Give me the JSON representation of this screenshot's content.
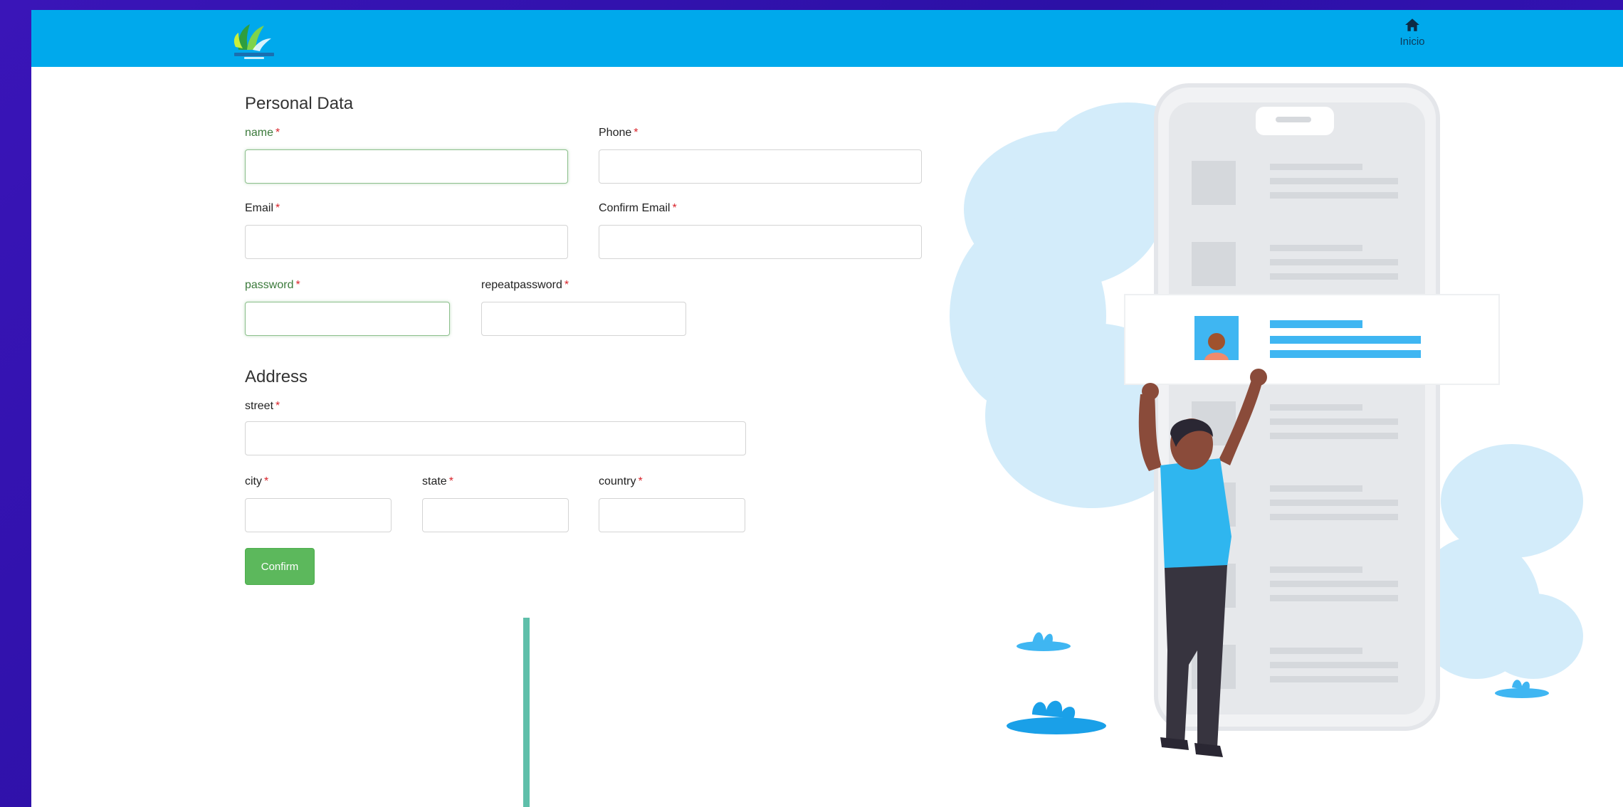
{
  "header": {
    "home_label": "Inicio",
    "home_icon": "home-icon",
    "logo_icon": "leaf-logo-icon",
    "colors": {
      "bar": "#00a9ec"
    }
  },
  "form": {
    "personal_title": "Personal Data",
    "address_title": "Address",
    "required_mark": "*",
    "fields": {
      "name": {
        "label": "name",
        "value": "",
        "placeholder": ""
      },
      "phone": {
        "label": "Phone",
        "value": "",
        "placeholder": ""
      },
      "email": {
        "label": "Email",
        "value": "",
        "placeholder": ""
      },
      "confirm_email": {
        "label": "Confirm Email",
        "value": "",
        "placeholder": ""
      },
      "password": {
        "label": "password",
        "value": "",
        "placeholder": ""
      },
      "repeat_password": {
        "label": "repeatpassword",
        "value": "",
        "placeholder": ""
      },
      "street": {
        "label": "street",
        "value": "",
        "placeholder": ""
      },
      "city": {
        "label": "city",
        "value": "",
        "placeholder": ""
      },
      "state": {
        "label": "state",
        "value": "",
        "placeholder": ""
      },
      "country": {
        "label": "country",
        "value": "",
        "placeholder": ""
      }
    },
    "confirm_label": "Confirm",
    "colors": {
      "button": "#5cb85c",
      "required": "#d9242b",
      "accent_bar": "#5fbfaa"
    }
  },
  "illustration": {
    "icon": "person-reaching-phone-illustration",
    "colors": {
      "cloud": "#d3ecfa",
      "phone": "#e3e6ea",
      "highlight": "#3fb6f2",
      "shirt": "#2fb6ef",
      "pants": "#37343f"
    }
  }
}
